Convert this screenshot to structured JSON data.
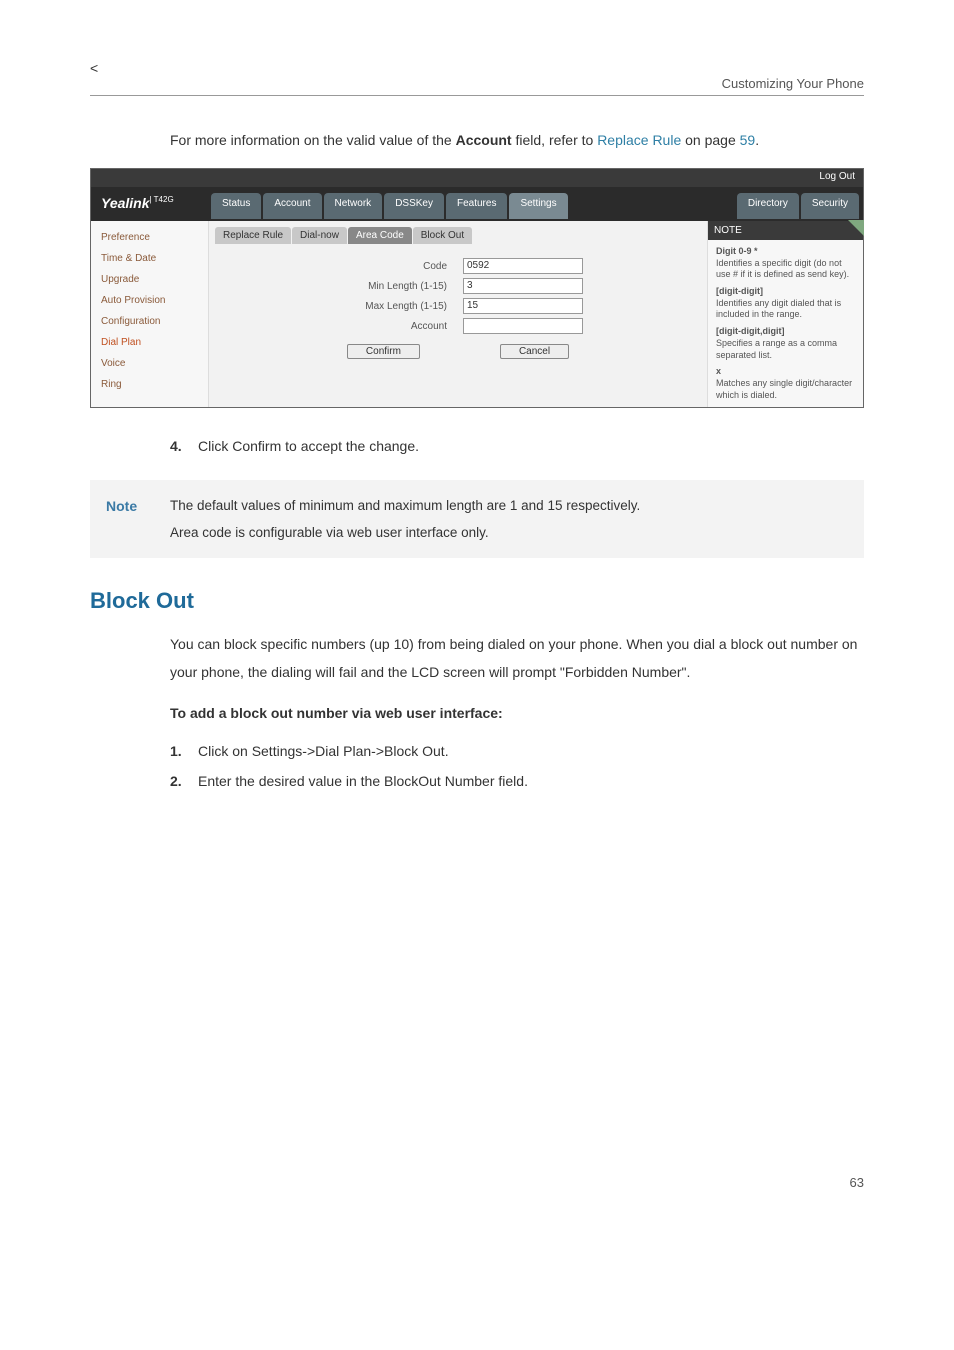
{
  "header": {
    "title": "Customizing Your Phone"
  },
  "intro": {
    "prefix": "For more information on the valid value of the ",
    "bold1": "Account",
    "mid": " field, refer to ",
    "link": "Replace Rule",
    "after": " on page ",
    "page": "59",
    "dot": "."
  },
  "screenshot": {
    "logout": "Log Out",
    "logo": "Yealink",
    "logo_sub": "| T42G",
    "tabs": [
      "Status",
      "Account",
      "Network",
      "DSSKey",
      "Features",
      "Settings"
    ],
    "tabs_right": [
      "Directory",
      "Security"
    ],
    "active_tab": "Settings",
    "sidebar": [
      "Preference",
      "Time & Date",
      "Upgrade",
      "Auto Provision",
      "Configuration",
      "Dial Plan",
      "Voice",
      "Ring"
    ],
    "sidebar_selected": "Dial Plan",
    "subtabs": [
      "Replace Rule",
      "Dial-now",
      "Area Code",
      "Block Out"
    ],
    "subtab_active": "Area Code",
    "form": {
      "code_label": "Code",
      "code_value": "0592",
      "min_label": "Min Length (1-15)",
      "min_value": "3",
      "max_label": "Max Length (1-15)",
      "max_value": "15",
      "account_label": "Account",
      "account_value": ""
    },
    "confirm": "Confirm",
    "cancel": "Cancel",
    "note_title": "NOTE",
    "note1_b": "Digit 0-9 *",
    "note1_t": "Identifies a specific digit (do not use # if it is defined as send key).",
    "note2_b": "[digit-digit]",
    "note2_t": "Identifies any digit dialed that is included in the range.",
    "note3_b": "[digit-digit,digit]",
    "note3_t": "Specifies a range as a comma separated list.",
    "note4_b": "x",
    "note4_t": "Matches any single digit/character which is dialed."
  },
  "step4": {
    "num": "4.",
    "prefix": "Click ",
    "bold": "Confirm",
    "suffix": " to accept the change."
  },
  "note": {
    "label": "Note",
    "line1": "The default values of minimum and maximum length are 1 and 15 respectively.",
    "line2": "Area code is configurable via web user interface only."
  },
  "blockout": {
    "heading": "Block Out",
    "p1": "You can block specific numbers (up 10) from being dialed on your phone. When you dial a block out number on your phone, the dialing will fail and the LCD screen will prompt \"Forbidden Number\".",
    "sub": "To add a block out number via web user interface:",
    "s1": {
      "num": "1.",
      "a": "Click on ",
      "b1": "Settings",
      "arr1": "->",
      "b2": "Dial Plan",
      "arr2": "->",
      "b3": "Block Out",
      "dot": "."
    },
    "s2": {
      "num": "2.",
      "a": "Enter the desired value in the ",
      "b": "BlockOut Number",
      "c": " field."
    }
  },
  "page": "63"
}
